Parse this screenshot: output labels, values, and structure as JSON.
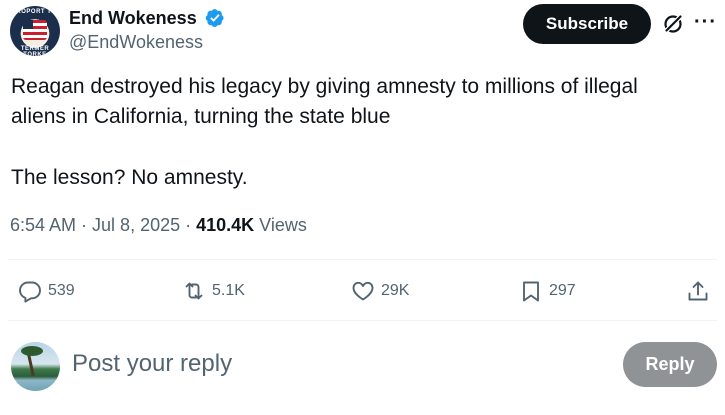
{
  "author": {
    "display_name": "End Wokeness",
    "handle": "@EndWokeness",
    "verified_icon": "verified-badge-icon",
    "avatar_text_top": "PROPORT TIS",
    "avatar_text_bottom": "TERMER TORKE"
  },
  "header": {
    "subscribe_label": "Subscribe",
    "grok_icon": "grok-icon",
    "more_icon": "more-icon",
    "more_glyph": "···"
  },
  "tweet": {
    "line1": "Reagan destroyed his legacy by giving amnesty to millions of illegal",
    "line2": "aliens in California, turning the state blue",
    "line3": "The lesson? No amnesty."
  },
  "meta": {
    "time": "6:54 AM",
    "separator": " · ",
    "date": "Jul 8, 2025",
    "views_count": "410.4K",
    "views_label": " Views"
  },
  "actions": {
    "replies": "539",
    "reposts": "5.1K",
    "likes": "29K",
    "bookmarks": "297",
    "icons": [
      "reply-icon",
      "repost-icon",
      "like-icon",
      "bookmark-icon",
      "share-icon"
    ]
  },
  "reply_bar": {
    "placeholder": "Post your reply",
    "button_label": "Reply"
  },
  "colors": {
    "text_primary": "#0f1419",
    "text_secondary": "#536471",
    "verified_blue": "#1d9bf0",
    "button_dark": "#0f1419",
    "reply_button_disabled": "#8f9396",
    "divider": "#eff3f4"
  }
}
